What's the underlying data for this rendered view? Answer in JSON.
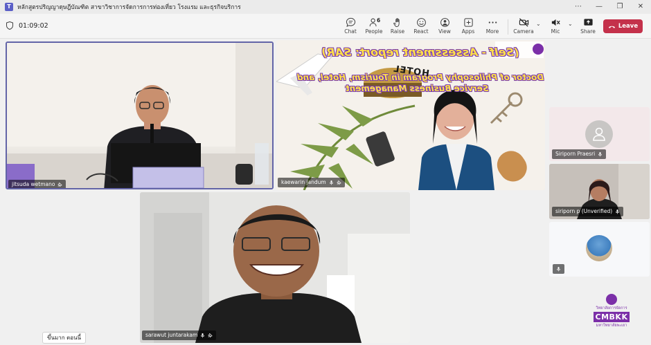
{
  "window": {
    "title": "หลักสูตรปริญญาดุษฎีบัณฑิต สาขาวิชาการจัดการการท่องเที่ยว โรงแรม และธุรกิจบริการ",
    "controls": [
      "⋯",
      "—",
      "❐",
      "✕"
    ]
  },
  "toolbar": {
    "timer": "01:09:02",
    "buttons": {
      "chat": "Chat",
      "people": "People",
      "people_count": "6",
      "raise": "Raise",
      "react": "React",
      "view": "View",
      "apps": "Apps",
      "more": "More",
      "camera": "Camera",
      "mic": "Mic",
      "share": "Share"
    },
    "leave": "Leave"
  },
  "participants": {
    "jitsuda": "jitsuda wetmano",
    "kaewarin": "kaewarin jandum",
    "sarawut": "sarawut juntarakam",
    "siriporn_praesi": "Siriporn Praesri",
    "siriporn_p": "siriporn p (Unverified)"
  },
  "background_text": {
    "line1": "(Self - Assessment report: SAR)",
    "line2": "Doctor of Philosophy Program in Tourism, Hotel, and",
    "line3": "Service Business Management",
    "hotel_sign": "HOTEL"
  },
  "bottom_chip": "ขึ้นมาก ตอนนี้",
  "brand": {
    "top": "วิทยาลัยการจัดการ",
    "mark": "CMBKK",
    "bottom": "มหาวิทยาลัยพะเยา",
    "color": "#7b2fa8"
  },
  "colors": {
    "accent": "#6264a7",
    "leave": "#c4314b"
  }
}
